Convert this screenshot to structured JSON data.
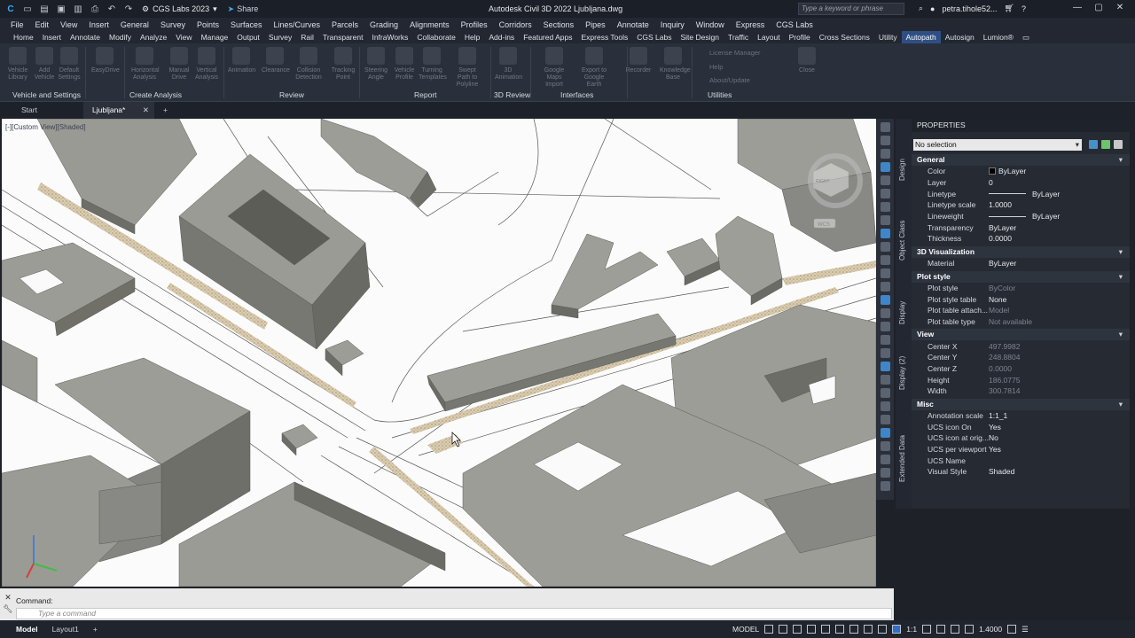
{
  "app": {
    "title": "Autodesk Civil 3D 2022   Ljubljana.dwg",
    "workspace": "CGS Labs 2023",
    "share_label": "Share",
    "search_placeholder": "Type a keyword or phrase",
    "user_name": "petra.tihole52...",
    "accent_color": "#2f4f84"
  },
  "menubar": [
    "File",
    "Edit",
    "View",
    "Insert",
    "General",
    "Survey",
    "Points",
    "Surfaces",
    "Lines/Curves",
    "Parcels",
    "Grading",
    "Alignments",
    "Profiles",
    "Corridors",
    "Sections",
    "Pipes",
    "Annotate",
    "Inquiry",
    "Window",
    "Express",
    "CGS Labs"
  ],
  "ribbon_tabs": [
    "Home",
    "Insert",
    "Annotate",
    "Modify",
    "Analyze",
    "View",
    "Manage",
    "Output",
    "Survey",
    "Rail",
    "Transparent",
    "InfraWorks",
    "Collaborate",
    "Help",
    "Add-ins",
    "Featured Apps",
    "Express Tools",
    "CGS Labs",
    "Site Design",
    "Traffic",
    "Layout",
    "Profile",
    "Cross Sections",
    "Utility",
    "Autopath",
    "Autosign",
    "Lumion®"
  ],
  "active_ribbon_tab": "Autopath",
  "ribbon": {
    "buttons": [
      "Vehicle Library",
      "Add Vehicle",
      "Default Settings",
      "EasyDrive",
      "Horizontal Analysis",
      "Manual Drive",
      "Vertical Analysis",
      "Animation",
      "Clearance",
      "Collision Detection",
      "Tracking Point",
      "Steering Angle",
      "Vehicle Profile",
      "Turning Templates",
      "Swept Path to Polyline",
      "3D Animation",
      "Google Maps Import",
      "Export to Google Earth",
      "Recorder",
      "Knowledge Base",
      "Close"
    ],
    "panels": [
      "Vehicle and Settings",
      "Create Analysis",
      "Review",
      "Report",
      "3D Review",
      "Interfaces",
      "Utilities"
    ],
    "utilities_items": [
      "License Manager",
      "Help",
      "About/Update"
    ]
  },
  "doc_tabs": [
    "Start",
    "Ljubljana*"
  ],
  "viewport": {
    "label": "[-][Custom View][Shaded]",
    "viewcube_face": "RIGHT",
    "wcs_label": "WCS"
  },
  "side_tabs": [
    "Design",
    "Object Class",
    "Display",
    "Display (2)",
    "Extended Data"
  ],
  "properties": {
    "title": "PROPERTIES",
    "selection": "No selection",
    "sections": [
      {
        "name": "General",
        "rows": [
          {
            "k": "Color",
            "v": "ByLayer",
            "swatch": true
          },
          {
            "k": "Layer",
            "v": "0"
          },
          {
            "k": "Linetype",
            "v": "ByLayer",
            "line": true
          },
          {
            "k": "Linetype scale",
            "v": "1.0000"
          },
          {
            "k": "Lineweight",
            "v": "ByLayer",
            "line": true
          },
          {
            "k": "Transparency",
            "v": "ByLayer"
          },
          {
            "k": "Thickness",
            "v": "0.0000"
          }
        ]
      },
      {
        "name": "3D Visualization",
        "rows": [
          {
            "k": "Material",
            "v": "ByLayer"
          }
        ]
      },
      {
        "name": "Plot style",
        "rows": [
          {
            "k": "Plot style",
            "v": "ByColor",
            "dim": true
          },
          {
            "k": "Plot style table",
            "v": "None"
          },
          {
            "k": "Plot table attach...",
            "v": "Model",
            "dim": true
          },
          {
            "k": "Plot table type",
            "v": "Not available",
            "dim": true
          }
        ]
      },
      {
        "name": "View",
        "rows": [
          {
            "k": "Center X",
            "v": "497.9982",
            "dim": true
          },
          {
            "k": "Center Y",
            "v": "248.8804",
            "dim": true
          },
          {
            "k": "Center Z",
            "v": "0.0000",
            "dim": true
          },
          {
            "k": "Height",
            "v": "186.0775",
            "dim": true
          },
          {
            "k": "Width",
            "v": "300.7814",
            "dim": true
          }
        ]
      },
      {
        "name": "Misc",
        "rows": [
          {
            "k": "Annotation scale",
            "v": "1:1_1"
          },
          {
            "k": "UCS icon On",
            "v": "Yes"
          },
          {
            "k": "UCS icon at orig...",
            "v": "No"
          },
          {
            "k": "UCS per viewport",
            "v": "Yes"
          },
          {
            "k": "UCS Name",
            "v": ""
          },
          {
            "k": "Visual Style",
            "v": "Shaded"
          }
        ]
      }
    ]
  },
  "command": {
    "history": "Command:",
    "placeholder": "Type a command"
  },
  "status": {
    "layout_tabs": [
      "Model",
      "Layout1"
    ],
    "model_label": "MODEL",
    "scale": "1:1",
    "zoom": "1.4000"
  }
}
